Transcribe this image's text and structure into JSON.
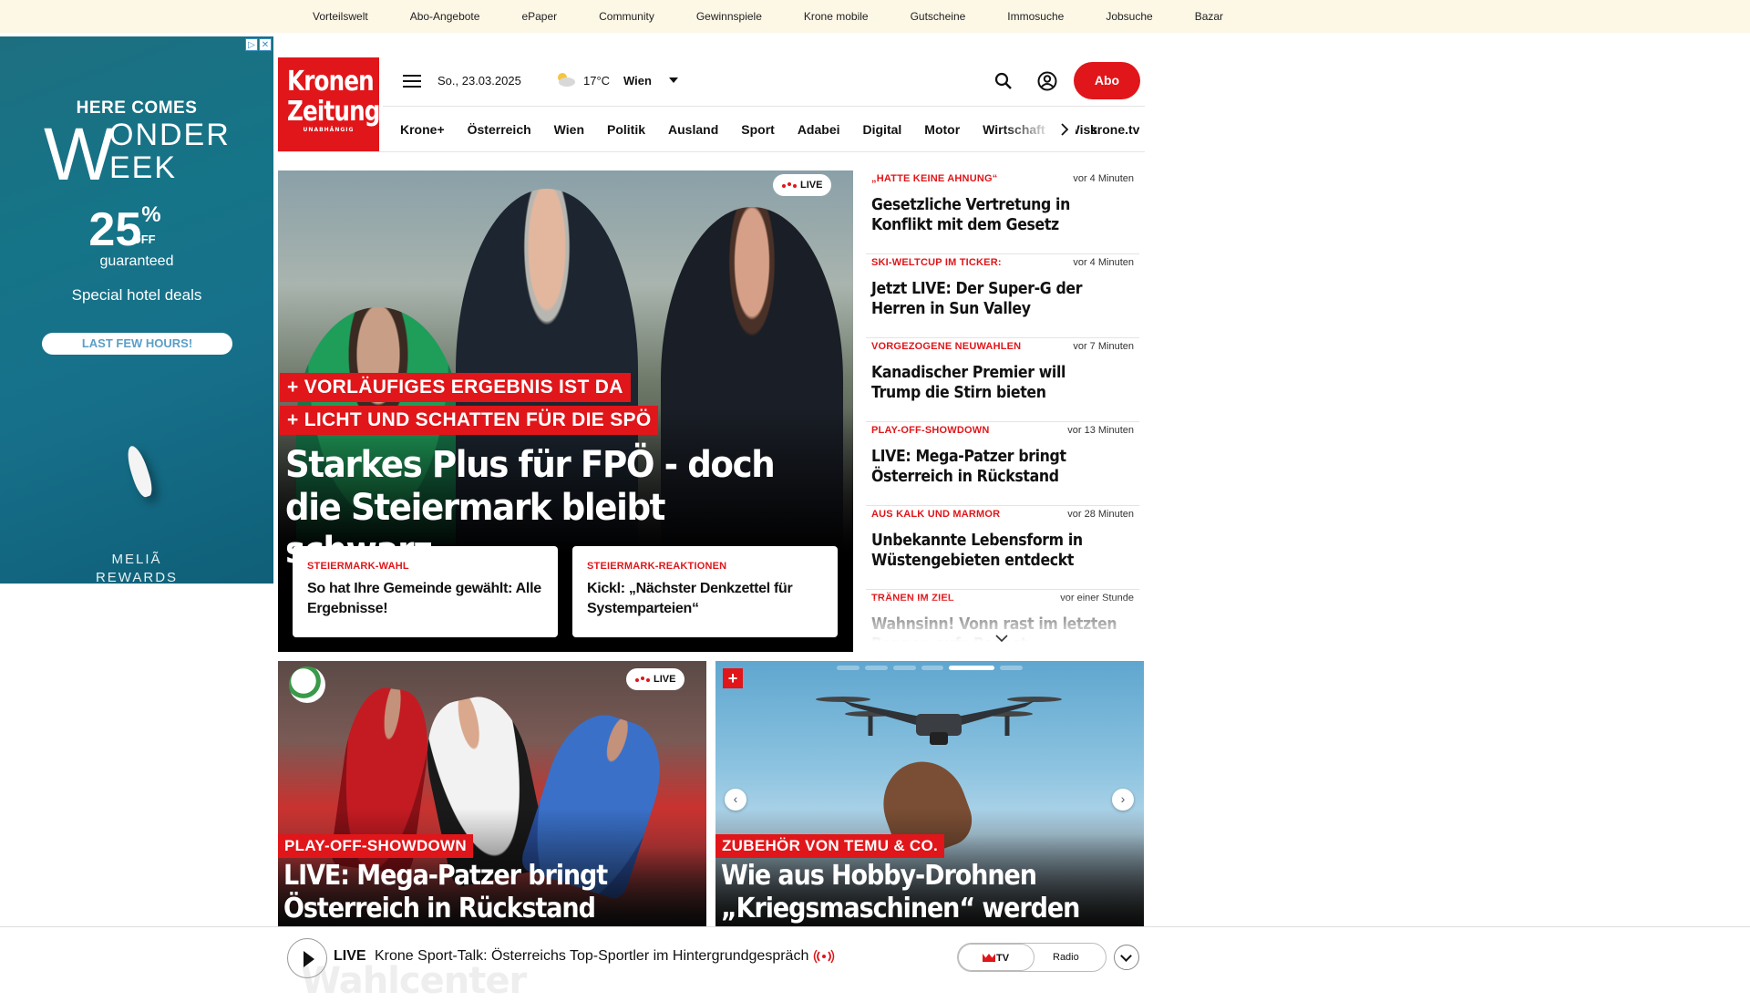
{
  "topbar": {
    "links": [
      "Vorteilswelt",
      "Abo-Angebote",
      "ePaper",
      "Community",
      "Gewinnspiele",
      "Krone mobile",
      "Gutscheine",
      "Immosuche",
      "Jobsuche",
      "Bazar"
    ]
  },
  "ad": {
    "headline": "HERE COMES",
    "brand_w": "W",
    "brand_rest1": "ONDER",
    "brand_rest2": "EEK",
    "percent": "25",
    "percent_sign": "%",
    "off": "OFF",
    "guaranteed": "guaranteed",
    "deals": "Special hotel deals",
    "cta": "LAST FEW HOURS!",
    "sponsor_line1": "MELIÃ",
    "sponsor_line2": "REWARDS"
  },
  "header": {
    "logo_line1": "Kronen",
    "logo_line2": "Zeitung",
    "logo_tagline": "UNABHÄNGIG",
    "date": "So., 23.03.2025",
    "temperature": "17°C",
    "city": "Wien",
    "abo_label": "Abo"
  },
  "nav": {
    "items": [
      "Krone+",
      "Österreich",
      "Wien",
      "Politik",
      "Ausland",
      "Sport",
      "Adabei",
      "Digital",
      "Motor",
      "Wirtschaft",
      "Wiss"
    ],
    "tv_link": "krone.tv"
  },
  "hero": {
    "live_label": "LIVE",
    "kicker1": "+ VORLÄUFIGES ERGEBNIS IST DA",
    "kicker2": "+ LICHT UND SCHATTEN FÜR DIE SPÖ",
    "headline_line1": "Starkes Plus für FPÖ - doch",
    "headline_line2": "die Steiermark bleibt schwarz",
    "subcards": [
      {
        "kicker": "STEIERMARK-WAHL",
        "title": "So hat Ihre Gemeinde gewählt: Alle Ergebnisse!"
      },
      {
        "kicker": "STEIERMARK-REAKTIONEN",
        "title": "Kickl: „Nächster Denkzettel für Systemparteien“"
      }
    ]
  },
  "ticker": {
    "items": [
      {
        "kicker": "„HATTE KEINE AHNUNG“",
        "time": "vor 4 Minuten",
        "title": "Gesetzliche Vertretung in Konflikt mit dem Gesetz"
      },
      {
        "kicker": "SKI-WELTCUP IM TICKER:",
        "time": "vor 4 Minuten",
        "title": "Jetzt LIVE: Der Super-G der Herren in Sun Valley"
      },
      {
        "kicker": "VORGEZOGENE NEUWAHLEN",
        "time": "vor 7 Minuten",
        "title": "Kanadischer Premier will Trump die Stirn bieten"
      },
      {
        "kicker": "PLAY-OFF-SHOWDOWN",
        "time": "vor 13 Minuten",
        "title": "LIVE: Mega-Patzer bringt Österreich in Rückstand"
      },
      {
        "kicker": "AUS KALK UND MARMOR",
        "time": "vor 28 Minuten",
        "title": "Unbekannte Lebensform in Wüstengebieten entdeckt"
      },
      {
        "kicker": "TRÄNEN IM ZIEL",
        "time": "vor einer Stunde",
        "title": "Wahnsinn! Vonn rast im letzten Rennen aufs Podest"
      }
    ]
  },
  "cards": [
    {
      "live_label": "LIVE",
      "kicker": "PLAY-OFF-SHOWDOWN",
      "title_line1": "LIVE: Mega-Patzer bringt",
      "title_line2": "Österreich in Rückstand"
    },
    {
      "plus": "+",
      "kicker": "ZUBEHÖR VON TEMU & CO.",
      "title_line1": "Wie aus Hobby-Drohnen",
      "title_line2": "„Kriegsmaschinen“ werden",
      "prev": "‹",
      "next": "›"
    }
  ],
  "player": {
    "live_label": "LIVE",
    "title": "Krone Sport-Talk: Österreichs Top-Sportler im Hintergrundgespräch",
    "tv_label": "TV",
    "radio_label": "Radio",
    "ghost_text": "Wahlcenter"
  },
  "colors": {
    "brand_red": "#e0161a",
    "topbar_bg": "#fdf7e6"
  }
}
